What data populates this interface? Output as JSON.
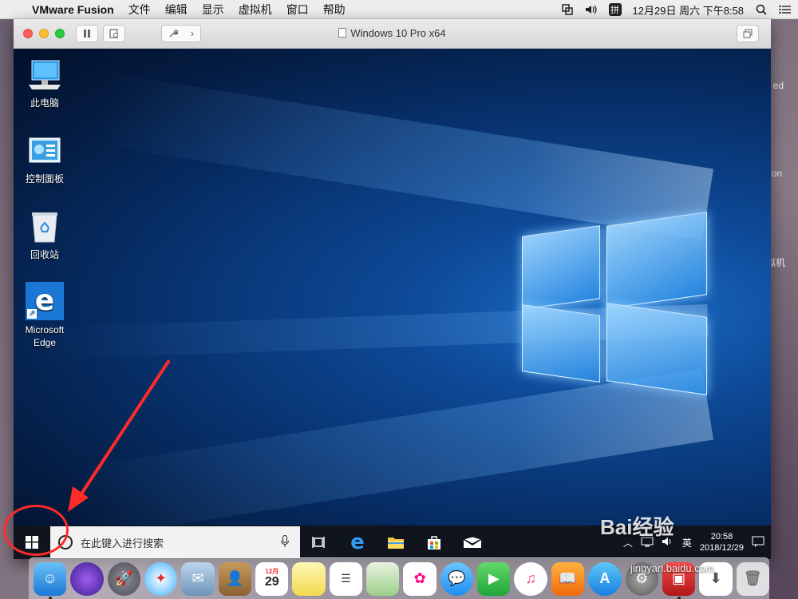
{
  "menubar": {
    "app_name": "VMware Fusion",
    "items": [
      "文件",
      "编辑",
      "显示",
      "虚拟机",
      "窗口",
      "帮助"
    ],
    "input_method": "拼",
    "datetime": "12月29日 周六 下午8:58"
  },
  "mac_desktop_side_text": [
    "ed",
    "on",
    "拟机"
  ],
  "vm_window": {
    "title": "Windows 10 Pro x64"
  },
  "desktop_icons": [
    {
      "label": "此电脑",
      "icon": "computer-icon"
    },
    {
      "label": "控制面板",
      "icon": "control-panel-icon"
    },
    {
      "label": "回收站",
      "icon": "recycle-bin-icon"
    },
    {
      "label": "Microsoft Edge",
      "icon": "edge-icon"
    }
  ],
  "taskbar": {
    "search_placeholder": "在此键入进行搜索",
    "ime_label": "英",
    "time": "20:58",
    "date": "2018/12/29"
  },
  "dock": {
    "calendar_day": "29",
    "calendar_month": "12月"
  },
  "watermark": {
    "text": "Bai经验",
    "url": "jingyan.baidu.com"
  },
  "colors": {
    "annotation": "#ff2a2a",
    "taskbar": "#0f141d",
    "menubar": "#eeeeee"
  }
}
